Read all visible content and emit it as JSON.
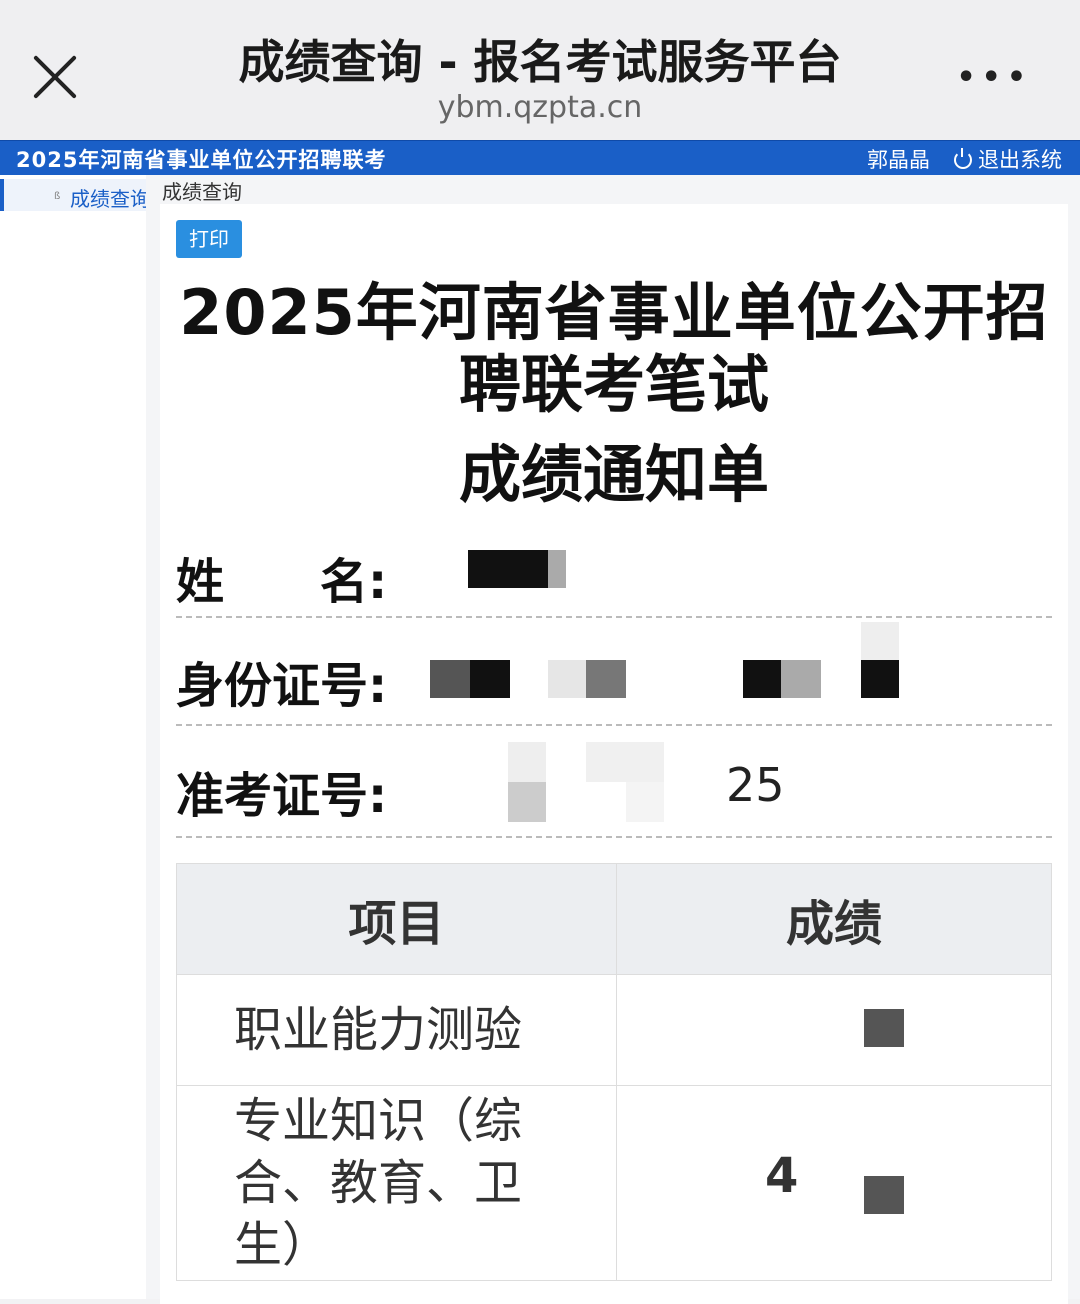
{
  "browser": {
    "title": "成绩查询 - 报名考试服务平台",
    "url": "ybm.qzpta.cn",
    "more_label": "•••"
  },
  "app_header": {
    "title": "2025年河南省事业单位公开招聘联考",
    "user": "郭晶晶",
    "logout_label": "退出系统",
    "bg_color": "#1a5fc7"
  },
  "sidebar": {
    "items": [
      {
        "label": "成绩查询",
        "icon": "nav-bullet-icon"
      }
    ]
  },
  "breadcrumb": "成绩查询",
  "notice": {
    "print_label": "打印",
    "title_line1": "2025年河南省事业单位公开招",
    "title_line2": "聘联考笔试",
    "title_line3": "成绩通知单",
    "fields": {
      "name_label": "姓　　名:",
      "id_label": "身份证号:",
      "ticket_label": "准考证号:",
      "ticket_visible": "25"
    },
    "table": {
      "headers": [
        "项目",
        "成绩"
      ],
      "rows": [
        {
          "subject": "职业能力测验",
          "score": ""
        },
        {
          "subject": "专业知识（综合、教育、卫生）",
          "score": "4"
        }
      ]
    }
  }
}
